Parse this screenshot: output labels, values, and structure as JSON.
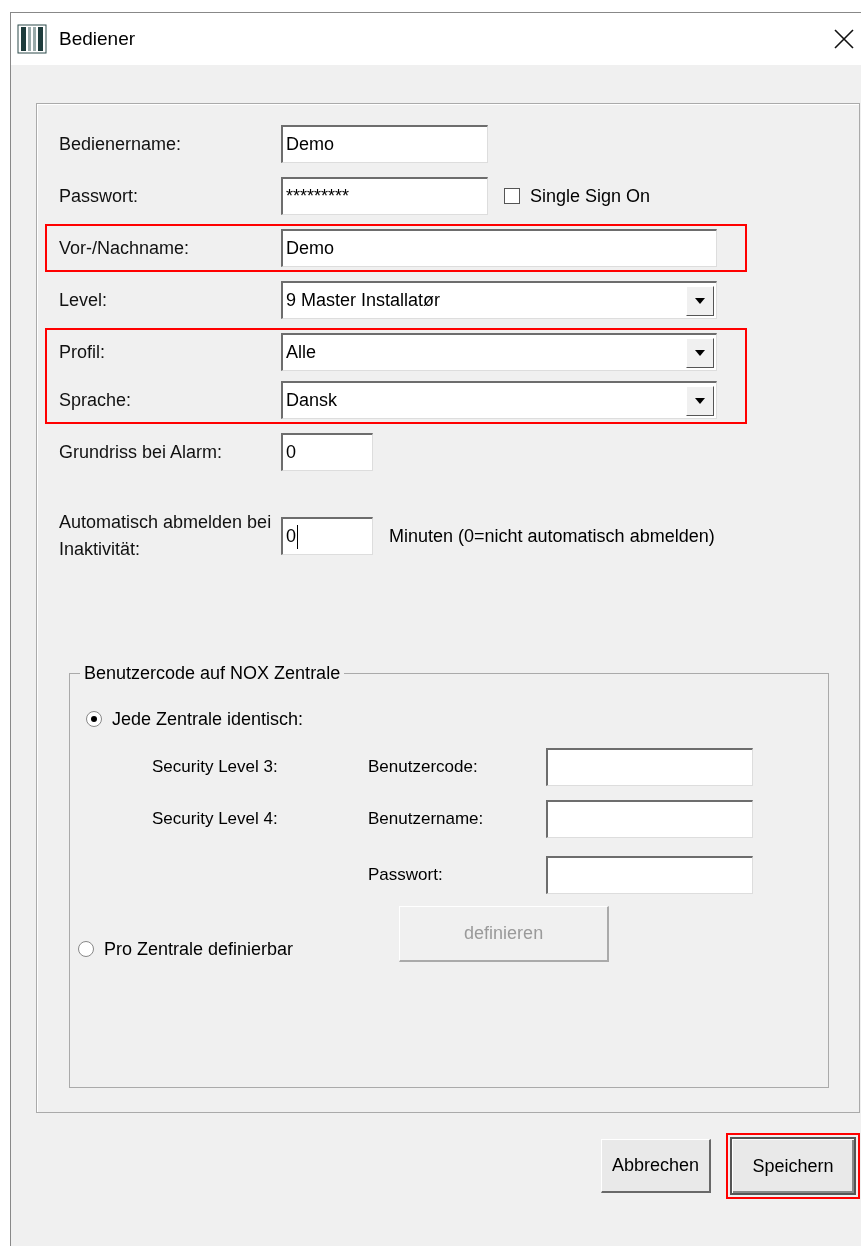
{
  "window": {
    "title": "Bediener"
  },
  "fields": [
    {
      "label": "Bedienername:",
      "kind": "text",
      "value": "Demo",
      "highlighted": false
    },
    {
      "label": "Passwort:",
      "kind": "password",
      "value": "*********",
      "highlighted": false,
      "checkbox": {
        "label": "Single Sign On",
        "checked": false
      }
    },
    {
      "label": "Vor-/Nachname:",
      "kind": "wide",
      "value": "Demo",
      "highlighted": true
    },
    {
      "label": "Level:",
      "kind": "select",
      "value": "9 Master Installatør",
      "highlighted": false
    },
    {
      "label": "Profil:",
      "kind": "select",
      "value": "Alle",
      "highlighted": true
    },
    {
      "label": "Sprache:",
      "kind": "select",
      "value": "Dansk",
      "highlighted": true
    },
    {
      "label": "Grundriss bei Alarm:",
      "kind": "number",
      "value": "0",
      "highlighted": false
    },
    {
      "label": "Automatisch abmelden bei Inaktivität:",
      "kind": "number",
      "value": "0",
      "focused": true,
      "highlighted": false,
      "suffix": "Minuten (0=nicht automatisch abmelden)"
    }
  ],
  "group": {
    "title": "Benutzercode auf NOX Zentrale",
    "options": [
      {
        "label": "Jede Zentrale identisch:",
        "selected": true,
        "rows": [
          {
            "security_level": "Security Level 3:",
            "fields": [
              {
                "label": "Benutzercode:"
              }
            ]
          },
          {
            "security_level": "Security Level 4:",
            "fields": [
              {
                "label": "Benutzername:"
              },
              {
                "label": "Passwort:"
              }
            ]
          }
        ]
      },
      {
        "label": "Pro Zentrale definierbar",
        "selected": false,
        "button": {
          "label": "definieren",
          "disabled": true
        }
      }
    ]
  },
  "buttons": [
    {
      "label": "Abbrechen",
      "highlighted": false,
      "default": false
    },
    {
      "label": "Speichern",
      "highlighted": true,
      "default": true
    }
  ]
}
